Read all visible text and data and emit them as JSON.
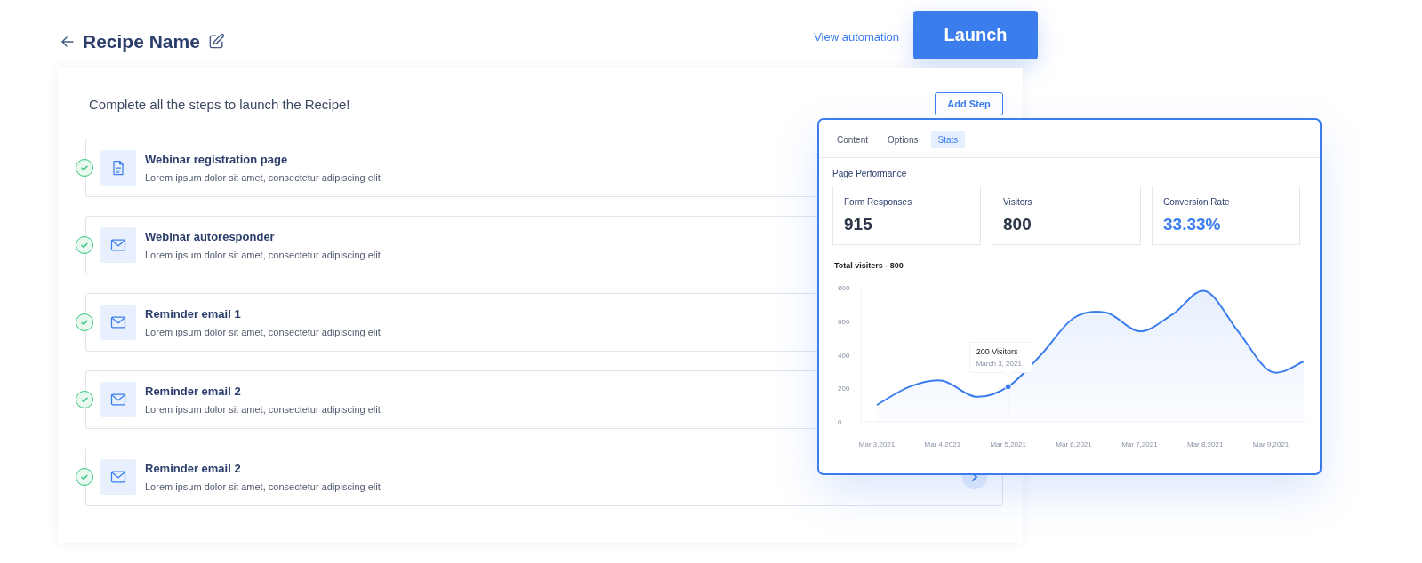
{
  "header": {
    "title": "Recipe Name",
    "link": "View automation",
    "launch_button": "Launch"
  },
  "main": {
    "heading": "Complete all the steps to launch the Recipe!",
    "add_button": "Add Step",
    "steps": [
      {
        "kind": "document",
        "title": "Webinar registration page",
        "description": "Lorem ipsum dolor sit amet, consectetur adipiscing elit",
        "completed": true
      },
      {
        "kind": "mail",
        "title": "Webinar autoresponder",
        "description": "Lorem ipsum dolor sit amet, consectetur adipiscing elit",
        "completed": true
      },
      {
        "kind": "mail",
        "title": "Reminder email 1",
        "description": "Lorem ipsum dolor sit amet, consectetur adipiscing elit",
        "completed": true
      },
      {
        "kind": "mail",
        "title": "Reminder email 2",
        "description": "Lorem ipsum dolor sit amet, consectetur adipiscing elit",
        "completed": true
      },
      {
        "kind": "mail",
        "title": "Reminder email 2",
        "description": "Lorem ipsum dolor sit amet, consectetur adipiscing elit",
        "completed": true
      }
    ]
  },
  "stats_panel": {
    "tabs": [
      {
        "label": "Content",
        "selected": false
      },
      {
        "label": "Options",
        "selected": false
      },
      {
        "label": "Stats",
        "selected": true
      }
    ],
    "section_title": "Page Performance",
    "metrics": [
      {
        "label": "Form Responses",
        "value": "915",
        "highlighted": false
      },
      {
        "label": "Visitors",
        "value": "800",
        "highlighted": false
      },
      {
        "label": "Conversion Rate",
        "value": "33.33%",
        "highlighted": true
      }
    ],
    "chart_title": "Total visiters - 800",
    "tooltip": {
      "value": "200 Visitors",
      "date": "March 3, 2021"
    },
    "chart_data": {
      "type": "area",
      "categories": [
        "Mar 3,2021",
        null,
        "Mar 4,2021",
        null,
        "Mar 5,2021",
        null,
        "Mar 6,2021",
        null,
        "Mar 7,2021",
        null,
        "Mar 8,2021",
        null,
        "Mar 9,2021",
        null
      ],
      "series": [
        {
          "color": "#3b7ded",
          "values": [
            100,
            210,
            245,
            150,
            210,
            400,
            620,
            650,
            540,
            640,
            780,
            540,
            300,
            360
          ]
        }
      ],
      "ylim": [
        0,
        800
      ],
      "yticks": [
        0,
        200,
        400,
        600,
        800
      ]
    }
  }
}
